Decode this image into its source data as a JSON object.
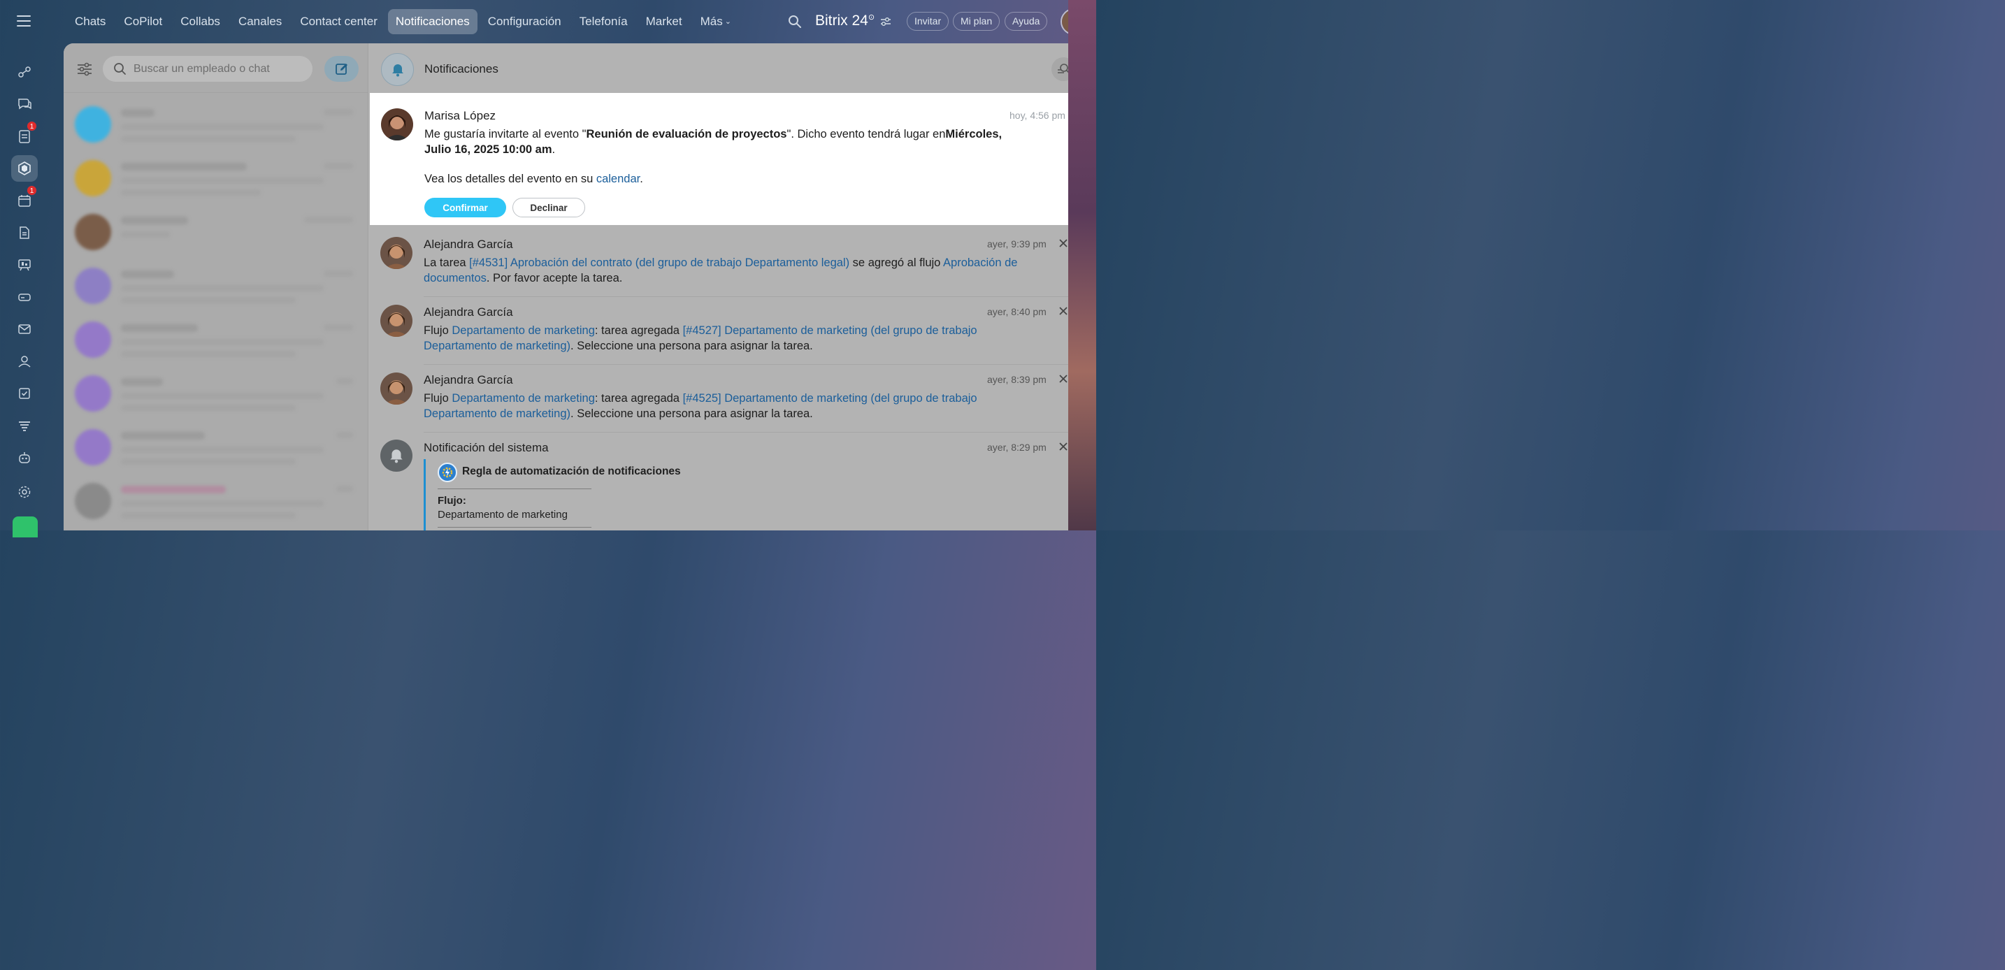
{
  "nav": {
    "items": [
      "Chats",
      "CoPilot",
      "Collabs",
      "Canales",
      "Contact center",
      "Notificaciones",
      "Configuración",
      "Telefonía",
      "Market",
      "Más"
    ],
    "active": "Notificaciones"
  },
  "brand": {
    "name": "Bitrix 24",
    "mark": "⊙"
  },
  "header_buttons": {
    "invite": "Invitar",
    "plan": "Mi plan",
    "help": "Ayuda"
  },
  "rail": {
    "badges": {
      "tasks": "1",
      "calendar": "1"
    },
    "icons": [
      "activity-icon",
      "chat-icon",
      "tasks-icon",
      "hexagon-icon",
      "calendar-icon",
      "document-icon",
      "board-icon",
      "drive-icon",
      "mail-icon",
      "contacts-icon",
      "checklist-icon",
      "funnel-icon",
      "bot-icon",
      "settings-icon",
      "rocket-icon"
    ]
  },
  "search": {
    "placeholder": "Buscar un empleado o chat"
  },
  "panel": {
    "title": "Notificaciones"
  },
  "notifications": [
    {
      "author": "Marisa López",
      "time": "hoy, 4:56 pm",
      "text_p1": "Me gustaría invitarte al evento \"",
      "event_name": "Reunión de evaluación de proyectos",
      "text_p2": "\". Dicho evento tendrá lugar en",
      "event_date": "Miércoles, Julio 16, 2025 10:00 am",
      "text_p3": ".",
      "details_p1": "Vea los detalles del evento en su ",
      "details_link": "calendar",
      "details_p2": ".",
      "confirm": "Confirmar",
      "decline": "Declinar"
    },
    {
      "author": "Alejandra García",
      "time": "ayer, 9:39 pm",
      "p1": "La tarea ",
      "link1": "[#4531] Aprobación del contrato (del grupo de trabajo Departamento legal)",
      "p2": " se agregó al flujo ",
      "link2": "Aprobación de documentos",
      "p3": ". Por favor acepte la tarea."
    },
    {
      "author": "Alejandra García",
      "time": "ayer, 8:40 pm",
      "p1": "Flujo ",
      "link1": "Departamento de marketing",
      "p2": ": tarea agregada ",
      "link2": "[#4527] Departamento de marketing (del grupo de trabajo Departamento de marketing)",
      "p3": ". Seleccione una persona para asignar la tarea."
    },
    {
      "author": "Alejandra García",
      "time": "ayer, 8:39 pm",
      "p1": "Flujo ",
      "link1": "Departamento de marketing",
      "p2": ": tarea agregada ",
      "link2": "[#4525] Departamento de marketing (del grupo de trabajo Departamento de marketing)",
      "p3": ". Seleccione una persona para asignar la tarea."
    },
    {
      "author": "Notificación del sistema",
      "time": "ayer, 8:29 pm",
      "rule_title": "Regla de automatización de notificaciones",
      "flow_label": "Flujo:",
      "flow_value": "Departamento de marketing"
    }
  ],
  "colors": {
    "accent": "#2fc6f6",
    "link": "#1b5e9a",
    "badge": "#e02b2b",
    "quote_bar": "#1c8fd2"
  }
}
